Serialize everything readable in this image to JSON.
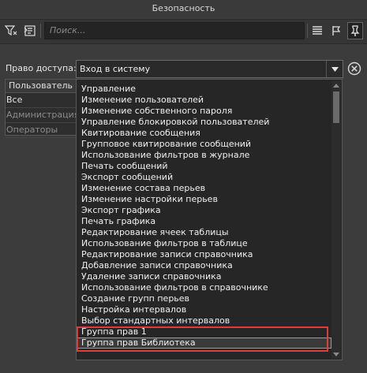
{
  "window": {
    "title": "Безопасность"
  },
  "toolbar": {
    "search_placeholder": "Поиск...",
    "icons": [
      "filter-icon",
      "filter-add-icon",
      "list-view-icon",
      "flag-icon",
      "pin-icon"
    ]
  },
  "access": {
    "label": "Право доступа:",
    "selected": "Вход в систему"
  },
  "grid": {
    "header": "Пользователь",
    "rows": [
      {
        "label": "Все",
        "dim": false
      },
      {
        "label": "Администрация",
        "dim": true
      },
      {
        "label": "Операторы",
        "dim": true
      }
    ]
  },
  "dropdown": {
    "items": [
      "Управление",
      "Изменение пользователей",
      "Изменение собственного пароля",
      "Управление блокировкой пользователей",
      "Квитирование сообщения",
      "Групповое квитирование сообщений",
      "Использование фильтров в журнале",
      "Печать сообщений",
      "Экспорт сообщений",
      "Изменение состава перьев",
      "Изменение настройки перьев",
      "Экспорт графика",
      "Печать графика",
      "Редактирование ячеек таблицы",
      "Использование фильтров в таблице",
      "Редактирование записи справочника",
      "Добавление записи справочника",
      "Удаление записи справочника",
      "Использование фильтров в справочнике",
      "Создание групп перьев",
      "Настройка интервалов",
      "Выбор стандартных интервалов",
      "Группа прав 1",
      "Группа прав Библиотека"
    ],
    "selected_index": 23
  },
  "colors": {
    "highlight": "#e03a3a",
    "background": "#3c3c3c"
  }
}
